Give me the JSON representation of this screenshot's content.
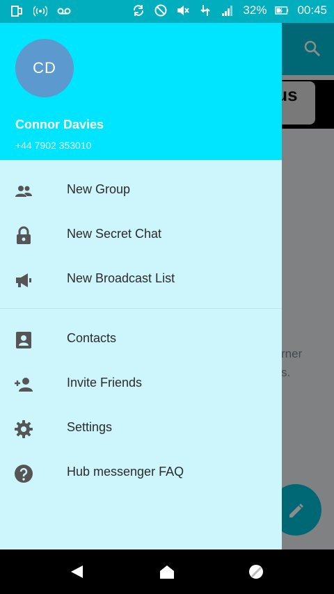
{
  "status_bar": {
    "battery_percent": "32%",
    "time": "00:45",
    "icons": [
      "sim-icon",
      "hotspot-icon",
      "voicemail-icon",
      "sync-icon",
      "blocked-icon",
      "mute-icon",
      "data-icon",
      "signal-icon",
      "battery-icon"
    ]
  },
  "background": {
    "partial_button_text": "lus",
    "partial_text_line1": "rner",
    "partial_text_line2": "s."
  },
  "drawer": {
    "avatar_initials": "CD",
    "user_name": "Connor Davies",
    "user_phone": "+44 7902 353010",
    "colors": {
      "header": "#00e5ff",
      "avatar": "#5b99cf",
      "body": "#ccf5fc"
    },
    "menu": [
      {
        "label": "New Group",
        "icon": "group-icon"
      },
      {
        "label": "New Secret Chat",
        "icon": "lock-icon"
      },
      {
        "label": "New Broadcast List",
        "icon": "megaphone-icon"
      },
      {
        "label": "Contacts",
        "icon": "contact-card-icon"
      },
      {
        "label": "Invite Friends",
        "icon": "add-person-icon"
      },
      {
        "label": "Settings",
        "icon": "gear-icon"
      },
      {
        "label": "Hub messenger FAQ",
        "icon": "help-icon"
      }
    ]
  },
  "nav_bar": {
    "buttons": [
      "back-icon",
      "home-icon",
      "recents-icon"
    ]
  }
}
